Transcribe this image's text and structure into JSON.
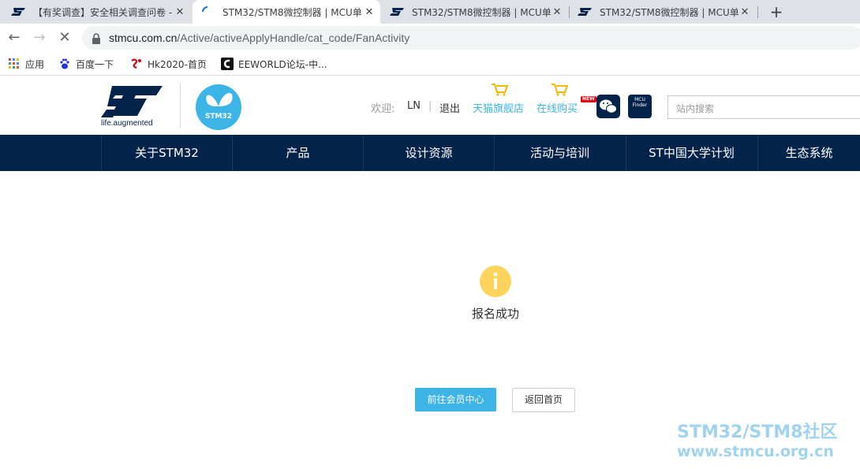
{
  "browser": {
    "tabs": [
      {
        "title": "【有奖调查】安全相关调查问卷 -",
        "close": "✕",
        "active": false
      },
      {
        "title": "STM32/STM8微控制器 | MCU单",
        "close": "✕",
        "active": true
      },
      {
        "title": "STM32/STM8微控制器 | MCU单",
        "close": "✕",
        "active": false
      },
      {
        "title": "STM32/STM8微控制器 | MCU单",
        "close": "✕",
        "active": false
      }
    ],
    "new_tab": "+",
    "nav": {
      "back": "←",
      "forward": "→",
      "reload": "✕"
    },
    "url": {
      "host": "stmcu.com.cn",
      "path": "/Active/activeApplyHandle/cat_code/FanActivity"
    },
    "bookmarks": [
      {
        "label": "应用",
        "icon": "apps-grid-icon"
      },
      {
        "label": "百度一下",
        "icon": "baidu-paw-icon"
      },
      {
        "label": "Hk2020-首页",
        "icon": "hk2020-logo-icon"
      },
      {
        "label": "EEWORLD论坛-中...",
        "icon": "eeworld-logo-icon"
      }
    ]
  },
  "site": {
    "logo_tagline": "life.augmented",
    "stm32_badge": "STM32",
    "welcome": "欢迎:",
    "username": "LN",
    "separator": "|",
    "logout": "退出",
    "tmall": "天猫旗舰店",
    "online_buy": "在线购买",
    "new_badge": "NEW",
    "mcu_finder": "MCU Finder",
    "search_placeholder": "站内搜索",
    "nav": [
      "关于STM32",
      "产品",
      "设计资源",
      "活动与培训",
      "ST中国大学计划",
      "生态系统"
    ]
  },
  "content": {
    "message": "报名成功",
    "primary_button": "前往会员中心",
    "secondary_button": "返回首页"
  },
  "watermark": {
    "line1": "STM32/STM8社区",
    "line2": "www.stmcu.org.cn"
  },
  "colors": {
    "navy": "#03234b",
    "accent": "#3cb4e6",
    "info": "#ffd45c"
  }
}
